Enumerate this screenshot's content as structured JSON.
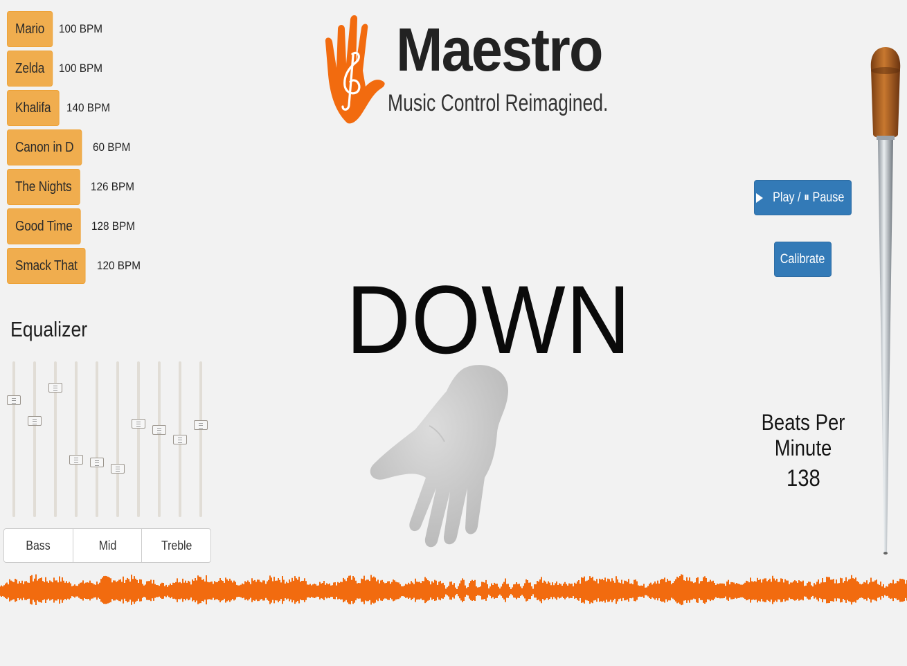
{
  "songs": [
    {
      "title": "Mario",
      "bpm": "100 BPM"
    },
    {
      "title": "Zelda",
      "bpm": "100 BPM"
    },
    {
      "title": "Khalifa",
      "bpm": "140 BPM"
    },
    {
      "title": "Canon in D",
      "bpm": "60 BPM"
    },
    {
      "title": "The Nights",
      "bpm": "126 BPM"
    },
    {
      "title": "Good Time",
      "bpm": "128 BPM"
    },
    {
      "title": "Smack That",
      "bpm": "120 BPM"
    }
  ],
  "equalizer": {
    "title": "Equalizer",
    "bands": [
      {
        "level": 0.75
      },
      {
        "level": 0.62
      },
      {
        "level": 0.83
      },
      {
        "level": 0.37
      },
      {
        "level": 0.35
      },
      {
        "level": 0.31
      },
      {
        "level": 0.6
      },
      {
        "level": 0.56
      },
      {
        "level": 0.5
      },
      {
        "level": 0.59
      }
    ],
    "tabs": [
      "Bass",
      "Mid",
      "Treble"
    ]
  },
  "logo": {
    "title": "Maestro",
    "tagline": "Music Control Reimagined."
  },
  "gesture": "DOWN",
  "controls": {
    "play_pause_label": "Play / ⏸ Pause",
    "calibrate_label": "Calibrate"
  },
  "bpm": {
    "label": "Beats Per Minute",
    "value": "138"
  },
  "colors": {
    "song_button": "#f0ad4e",
    "primary_button": "#337ab7",
    "waveform": "#f26b0f",
    "logo_accent": "#f26b0f"
  },
  "icons": {
    "play": "play-icon",
    "pause": "pause-icon",
    "logo": "hand-treble-clef-icon",
    "baton": "conductor-baton-icon",
    "hand": "hand-model-icon"
  }
}
